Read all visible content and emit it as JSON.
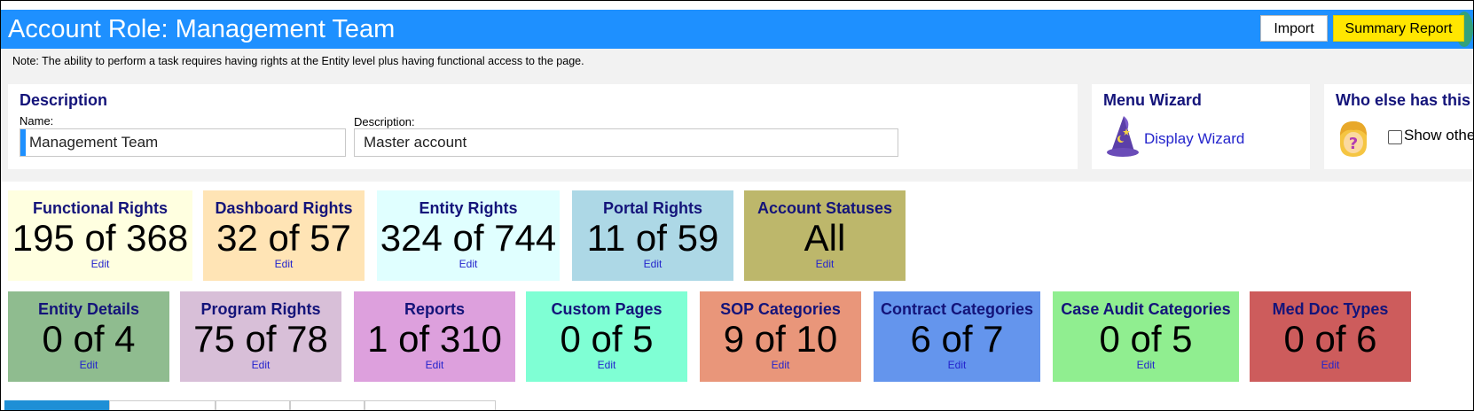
{
  "header": {
    "title": "Account Role: Management Team",
    "import_label": "Import",
    "summary_label": "Summary Report",
    "color": "#1e90ff"
  },
  "note": "Note: The ability to perform a task requires having rights at the Entity level plus having functional access to the page.",
  "description_panel": {
    "title": "Description",
    "name_label": "Name:",
    "name_value": "Management Team",
    "description_label": "Description:",
    "description_value": "Master account"
  },
  "menu_wizard": {
    "title": "Menu Wizard",
    "link": "Display Wizard",
    "icon": "wizard-hat-icon"
  },
  "who_else": {
    "title": "Who else has this",
    "checkbox_label": "Show othe",
    "checked": false,
    "icon": "question-person-icon"
  },
  "tiles_row1": [
    {
      "title": "Functional Rights",
      "value": "195 of 368",
      "edit": "Edit",
      "color": "#ffffe0"
    },
    {
      "title": "Dashboard Rights",
      "value": "32 of 57",
      "edit": "Edit",
      "color": "#ffe4b5"
    },
    {
      "title": "Entity Rights",
      "value": "324 of 744",
      "edit": "Edit",
      "color": "#e0ffff"
    },
    {
      "title": "Portal Rights",
      "value": "11 of 59",
      "edit": "Edit",
      "color": "#add8e6"
    },
    {
      "title": "Account Statuses",
      "value": "All",
      "edit": "Edit",
      "color": "#bdb76b"
    }
  ],
  "tiles_row2": [
    {
      "title": "Entity Details",
      "value": "0 of 4",
      "edit": "Edit",
      "color": "#8fbc8f"
    },
    {
      "title": "Program Rights",
      "value": "75 of 78",
      "edit": "Edit",
      "color": "#d8bfd8"
    },
    {
      "title": "Reports",
      "value": "1 of 310",
      "edit": "Edit",
      "color": "#dda0dd"
    },
    {
      "title": "Custom Pages",
      "value": "0 of 5",
      "edit": "Edit",
      "color": "#7fffd4"
    },
    {
      "title": "SOP Categories",
      "value": "9 of 10",
      "edit": "Edit",
      "color": "#e9967a"
    },
    {
      "title": "Contract Categories",
      "value": "6 of 7",
      "edit": "Edit",
      "color": "#6495ed"
    },
    {
      "title": "Case Audit Categories",
      "value": "0 of 5",
      "edit": "Edit",
      "color": "#90ee90"
    },
    {
      "title": "Med Doc Types",
      "value": "0 of 6",
      "edit": "Edit",
      "color": "#cd5c5c"
    }
  ]
}
